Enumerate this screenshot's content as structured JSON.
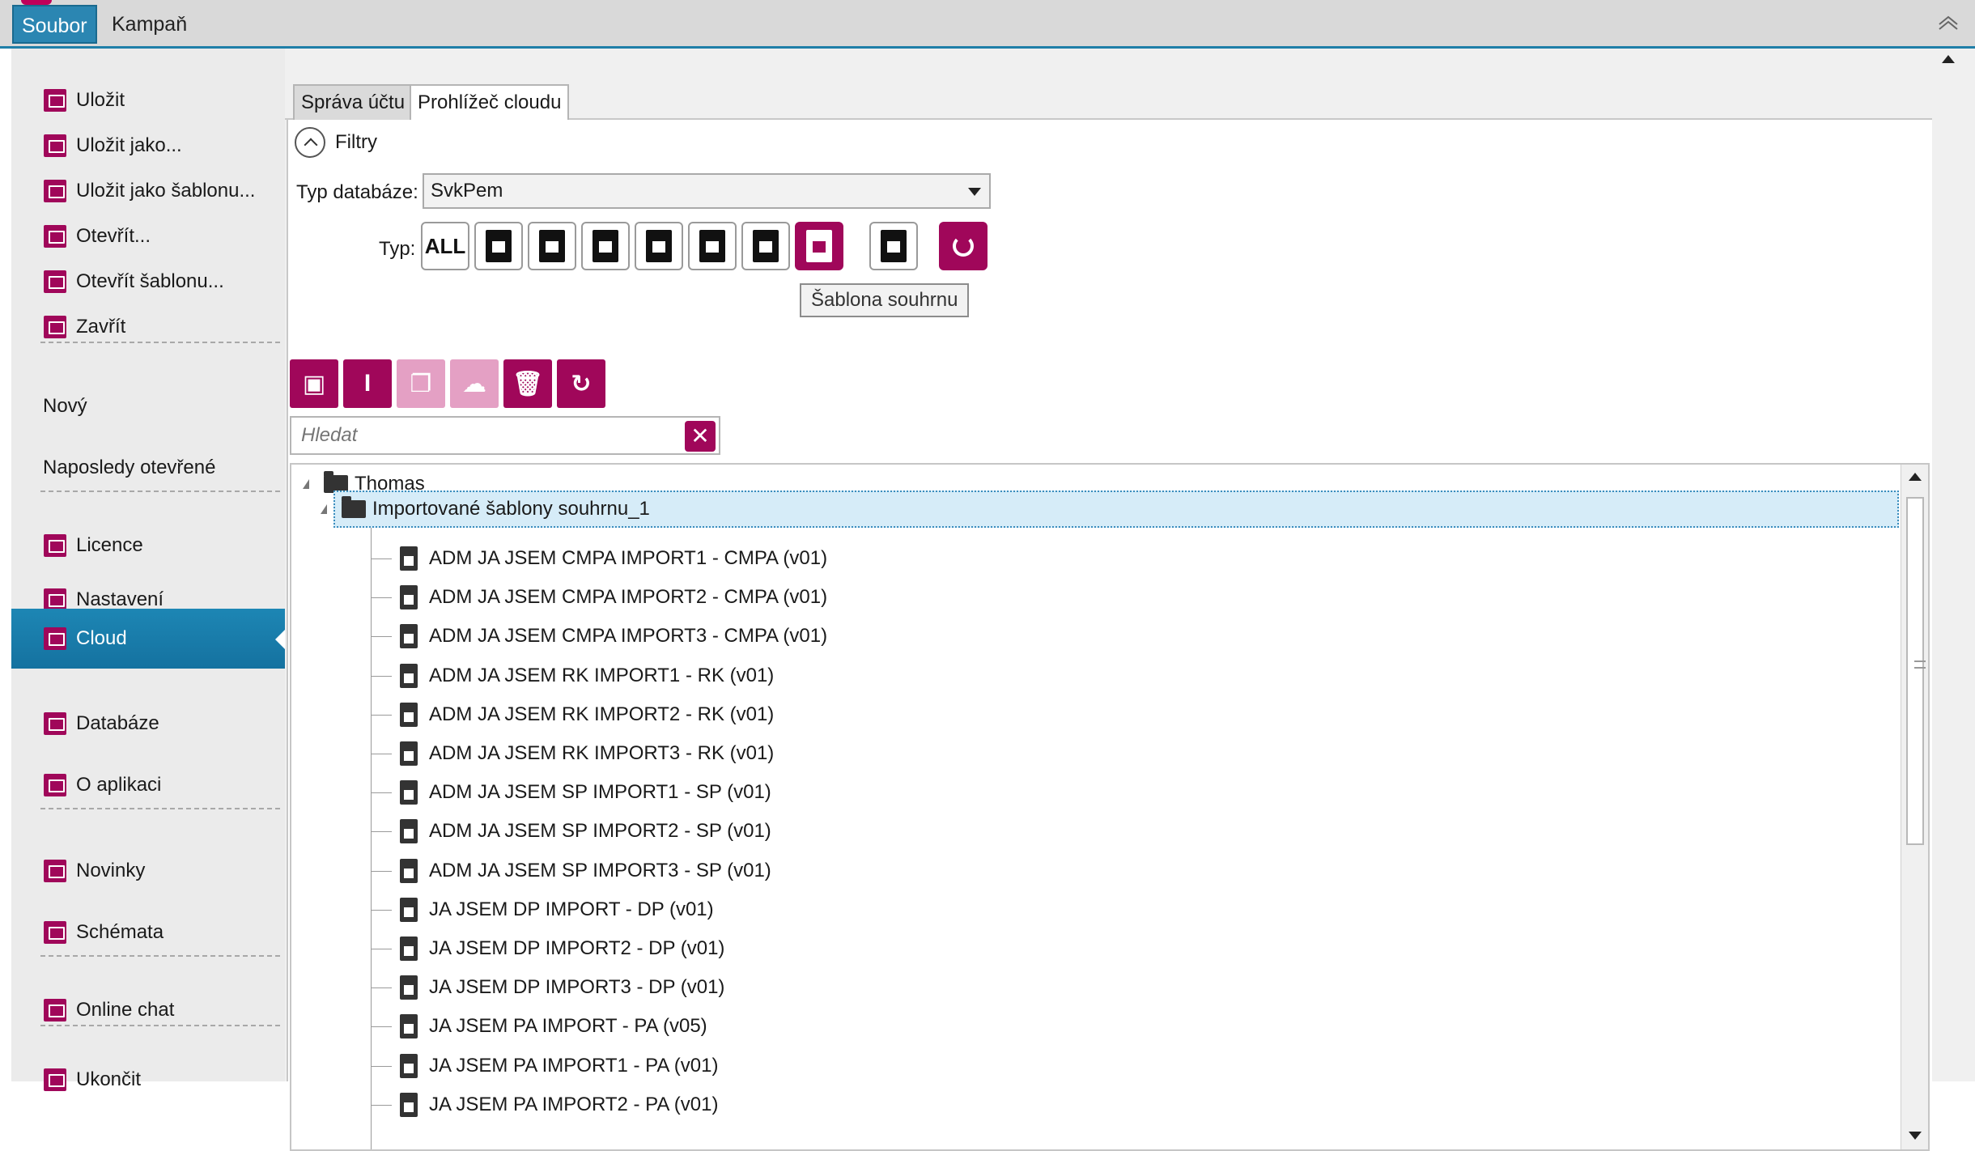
{
  "menu": {
    "file_tab": "Soubor",
    "campaign_tab": "Kampaň"
  },
  "sidebar": {
    "items": [
      {
        "label": "Uložit"
      },
      {
        "label": "Uložit jako..."
      },
      {
        "label": "Uložit jako šablonu..."
      },
      {
        "label": "Otevřít..."
      },
      {
        "label": "Otevřít šablonu..."
      },
      {
        "label": "Zavřít"
      },
      {
        "label": "Nový"
      },
      {
        "label": "Naposledy otevřené"
      },
      {
        "label": "Licence"
      },
      {
        "label": "Nastavení"
      },
      {
        "label": "Cloud"
      },
      {
        "label": "Databáze"
      },
      {
        "label": "O aplikaci"
      },
      {
        "label": "Novinky"
      },
      {
        "label": "Schémata"
      },
      {
        "label": "Online chat"
      },
      {
        "label": "Ukončit"
      }
    ],
    "active": "Cloud"
  },
  "tabs": {
    "account": "Správa účtu",
    "cloud_browser": "Prohlížeč cloudu"
  },
  "filters": {
    "toggle_label": "Filtry",
    "db_type_label": "Typ databáze:",
    "db_type_value": "SvkPem",
    "type_label": "Typ:",
    "type_all": "ALL",
    "tooltip": "Šablona souhrnu"
  },
  "search": {
    "placeholder": "Hledat"
  },
  "tree": {
    "root": "Thomas",
    "folder": "Importované šablony souhrnu_1",
    "files": [
      "ADM JA JSEM CMPA IMPORT1 - CMPA (v01)",
      "ADM JA JSEM CMPA IMPORT2 - CMPA (v01)",
      "ADM JA JSEM CMPA IMPORT3 - CMPA (v01)",
      "ADM JA JSEM RK IMPORT1 - RK (v01)",
      "ADM JA JSEM RK IMPORT2 - RK (v01)",
      "ADM JA JSEM RK IMPORT3 - RK (v01)",
      "ADM JA JSEM SP IMPORT1 - SP (v01)",
      "ADM JA JSEM SP IMPORT2 - SP (v01)",
      "ADM JA JSEM SP IMPORT3 - SP (v01)",
      "JA JSEM DP IMPORT - DP (v01)",
      "JA JSEM DP IMPORT2 - DP (v01)",
      "JA JSEM DP IMPORT3 - DP (v01)",
      "JA JSEM PA IMPORT - PA (v05)",
      "JA JSEM PA IMPORT1 - PA (v01)",
      "JA JSEM PA IMPORT2 - PA (v01)"
    ]
  },
  "colors": {
    "accent": "#a0075a",
    "active_nav": "#1d86b4"
  }
}
